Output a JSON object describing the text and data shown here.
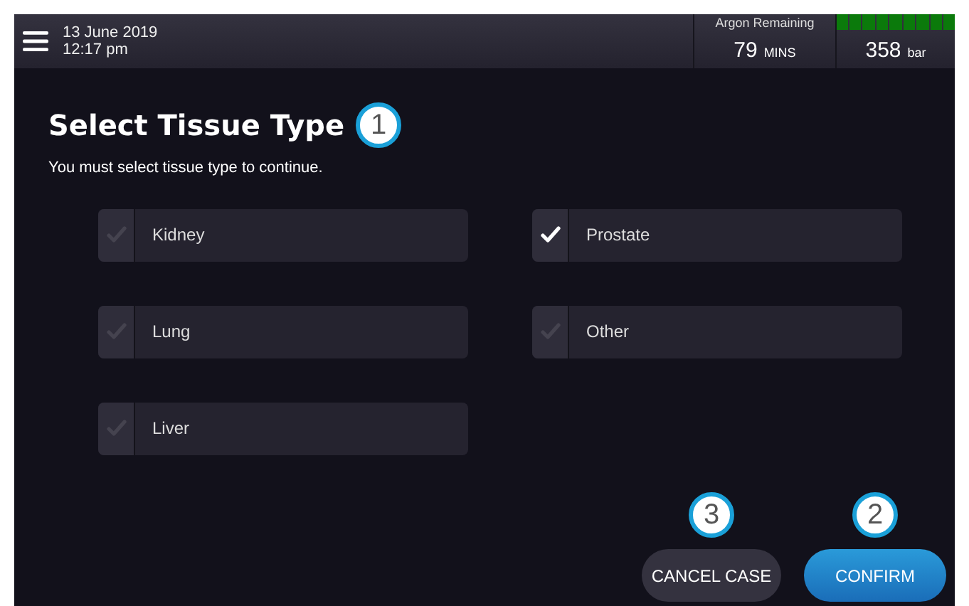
{
  "header": {
    "date": "13 June 2019",
    "time": "12:17 pm",
    "argon_label": "Argon Remaining",
    "argon_value": "79",
    "argon_unit": "MINS",
    "pressure_gauge": {
      "level": 1
    },
    "pressure_value": "358",
    "pressure_unit": "bar"
  },
  "title": "Select Tissue Type",
  "title_callout": "1",
  "subtitle": "You must select tissue type to continue.",
  "options": [
    {
      "label": "Kidney",
      "checked": false
    },
    {
      "label": "Prostate",
      "checked": true
    },
    {
      "label": "Lung",
      "checked": false
    },
    {
      "label": "Other",
      "checked": false
    },
    {
      "label": "Liver",
      "checked": false
    }
  ],
  "buttons": [
    {
      "label": "CANCEL CASE",
      "kind": "secondary",
      "callout": "3"
    },
    {
      "label": "CONFIRM",
      "kind": "primary",
      "callout": "2"
    }
  ]
}
